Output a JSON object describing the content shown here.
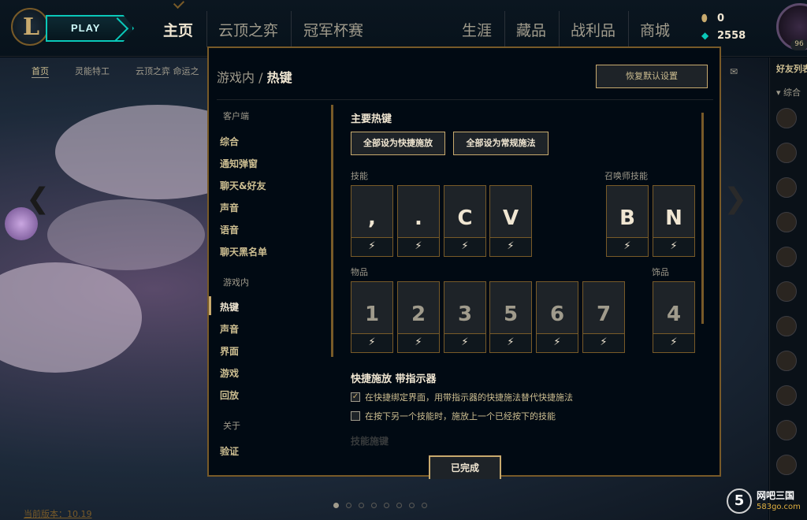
{
  "topbar": {
    "play_label": "PLAY",
    "logo_letter": "L",
    "nav": [
      "主页",
      "云顶之弈",
      "冠军杯赛",
      "生涯",
      "藏品",
      "战利品",
      "商城"
    ],
    "blue_essence": "0",
    "riot_points": "2558",
    "level": "96"
  },
  "subnav": [
    "首页",
    "灵能特工",
    "云顶之弈 命运之"
  ],
  "friends": {
    "title": "好友列表",
    "group": "综合"
  },
  "footer": {
    "version": "当前版本：10.19"
  },
  "watermark": {
    "line1": "网吧三国",
    "line2": "583go.com"
  },
  "modal": {
    "breadcrumb_parent": "游戏内",
    "breadcrumb_sep": "/",
    "breadcrumb_current": "热键",
    "reset_label": "恢复默认设置",
    "done_label": "已完成",
    "sidebar": {
      "client_header": "客户端",
      "client_items": [
        "综合",
        "通知弹窗",
        "聊天&好友",
        "声音",
        "语音",
        "聊天黑名单"
      ],
      "ingame_header": "游戏内",
      "ingame_items": [
        "热键",
        "声音",
        "界面",
        "游戏",
        "回放"
      ],
      "about_header": "关于",
      "about_items": [
        "验证"
      ]
    },
    "main_hotkeys": {
      "title": "主要热键",
      "btn_quick": "全部设为快捷施放",
      "btn_normal": "全部设为常规施法",
      "skills_label": "技能",
      "summoner_label": "召唤师技能",
      "skills": [
        ",",
        ".",
        "C",
        "V"
      ],
      "summoners": [
        "B",
        "N"
      ],
      "items_label": "物品",
      "trinket_label": "饰品",
      "items": [
        "1",
        "2",
        "3",
        "5",
        "6",
        "7"
      ],
      "trinket": "4"
    },
    "quickcast": {
      "title": "快捷施放 带指示器",
      "options": [
        {
          "label": "在快捷绑定界面，用带指示器的快捷施法替代快捷施法",
          "checked": true
        },
        {
          "label": "在按下另一个技能时，施放上一个已经按下的技能",
          "checked": false
        }
      ],
      "next_section": "技能施键"
    }
  }
}
